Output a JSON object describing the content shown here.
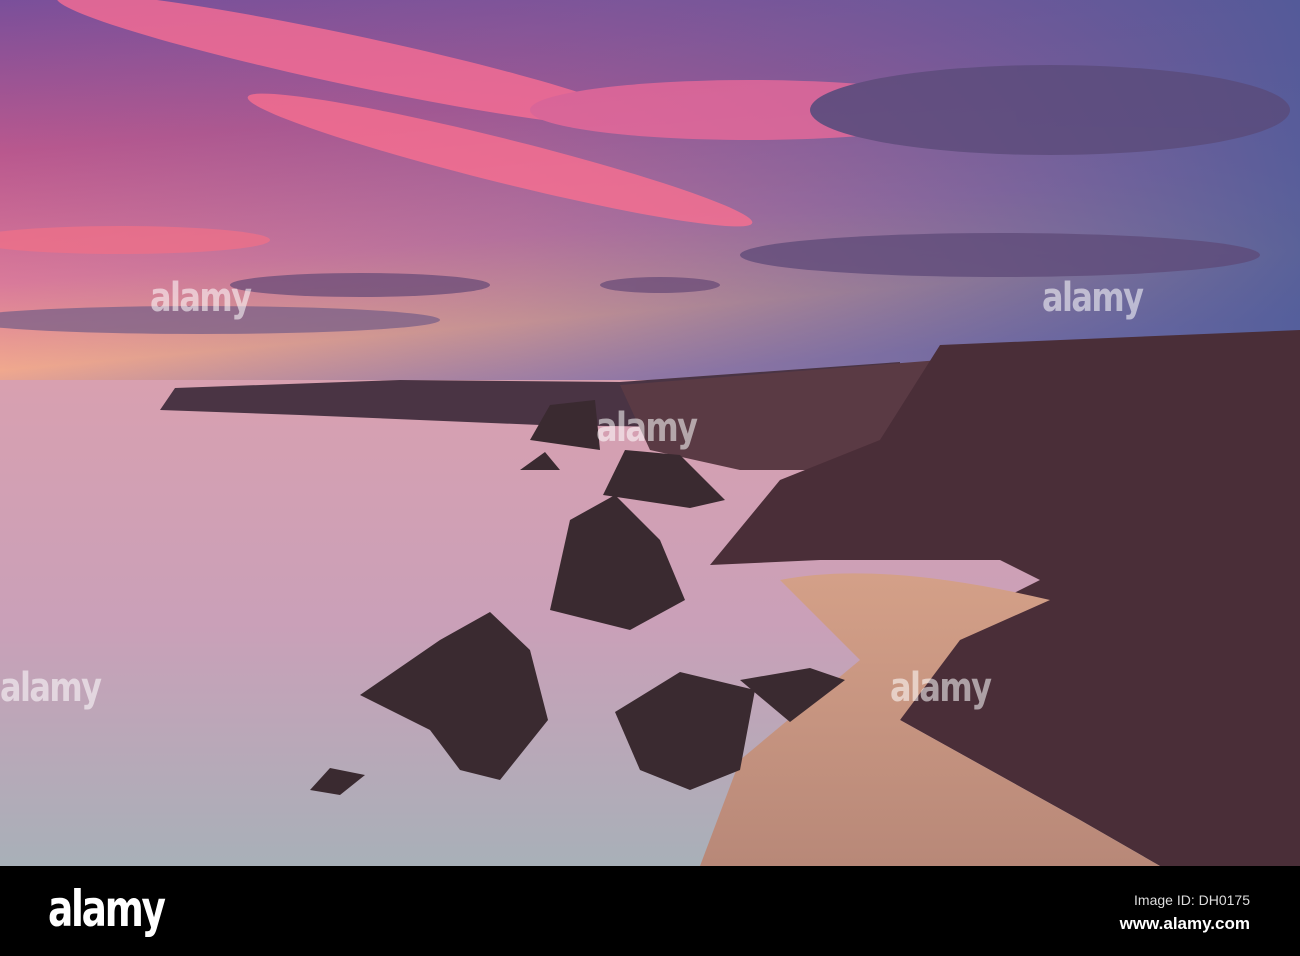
{
  "footer": {
    "logo": "alamy",
    "image_id": "Image ID: DH0175",
    "website": "www.alamy.com"
  },
  "watermark": "alamy",
  "colors": {
    "sky_top": "#5a5aa0",
    "sky_pink": "#e8607e",
    "horizon": "#f5b08a",
    "sea": "#d8a8b8",
    "cliff": "#4a3038",
    "sand": "#c89080"
  }
}
